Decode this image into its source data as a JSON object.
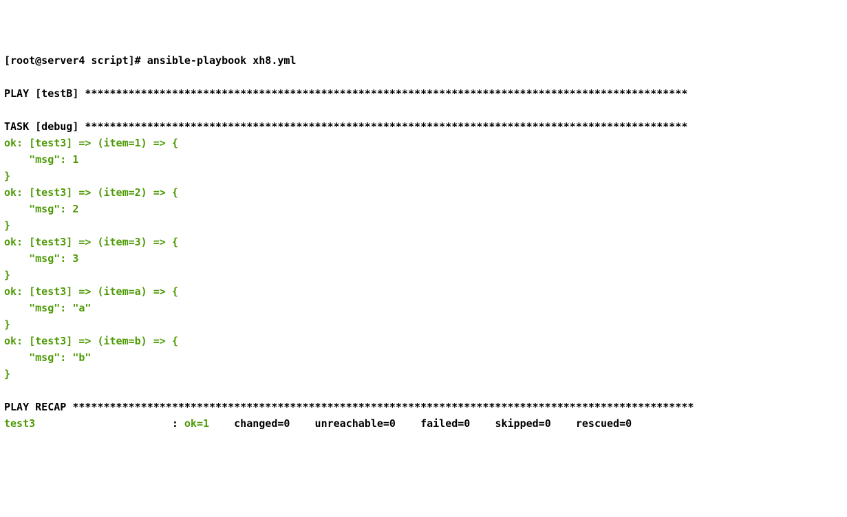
{
  "prompt": "[root@server4 script]# ",
  "command": "ansible-playbook xh8.yml",
  "play_prefix": "PLAY [",
  "play_name": "testB",
  "play_suffix": "] ",
  "play_stars": "*************************************************************************************************",
  "task_prefix": "TASK [",
  "task_name": "debug",
  "task_suffix": "] ",
  "task_stars": "*************************************************************************************************",
  "items": [
    {
      "header": "ok: [test3] => (item=1) => {",
      "msgline": "    \"msg\": 1",
      "close": "}"
    },
    {
      "header": "ok: [test3] => (item=2) => {",
      "msgline": "    \"msg\": 2",
      "close": "}"
    },
    {
      "header": "ok: [test3] => (item=3) => {",
      "msgline": "    \"msg\": 3",
      "close": "}"
    },
    {
      "header": "ok: [test3] => (item=a) => {",
      "msgline": "    \"msg\": \"a\"",
      "close": "}"
    },
    {
      "header": "ok: [test3] => (item=b) => {",
      "msgline": "    \"msg\": \"b\"",
      "close": "}"
    }
  ],
  "recap_prefix": "PLAY RECAP ",
  "recap_stars": "****************************************************************************************************",
  "recap": {
    "host": "test3",
    "pad": "                      ",
    "colon": ": ",
    "ok": "ok=1   ",
    "changed": " changed=0   ",
    "unreachable": " unreachable=0   ",
    "failed": " failed=0   ",
    "skipped": " skipped=0   ",
    "rescued": " rescued=0  "
  }
}
